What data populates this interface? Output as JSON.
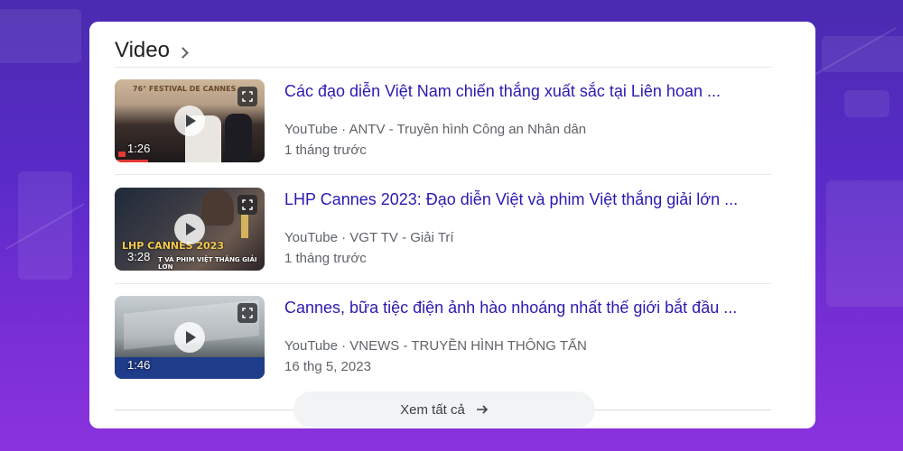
{
  "section": {
    "title": "Video"
  },
  "videos": [
    {
      "title": "Các đạo diễn Việt Nam chiến thắng xuất sắc tại Liên hoan ...",
      "source": "YouTube",
      "channel": "ANTV - Truyền hình Công an Nhân dân",
      "date": "1 tháng trước",
      "duration": "1:26",
      "overlay": "76° FESTIVAL DE CANNES",
      "progress": 0.22
    },
    {
      "title": "LHP Cannes 2023: Đạo diễn Việt và phim Việt thắng giải lớn ...",
      "source": "YouTube",
      "channel": "VGT TV - Giải Trí",
      "date": "1 tháng trước",
      "duration": "3:28",
      "overlay": "LHP CANNES 2023",
      "overlay2": "T VÀ PHIM VIỆT THẮNG GIẢI LỚN",
      "progress": 0
    },
    {
      "title": "Cannes, bữa tiệc điện ảnh hào nhoáng nhất thế giới bắt đầu ...",
      "source": "YouTube",
      "channel": "VNEWS - TRUYỀN HÌNH THÔNG TẤN",
      "date": "16 thg 5, 2023",
      "duration": "1:46",
      "overlay": "",
      "progress": 0
    }
  ],
  "see_all": {
    "label": "Xem tất cả"
  },
  "colors": {
    "link": "#2a1bb0",
    "meta": "#5f6368",
    "background": "#5a2bc8"
  },
  "icons": {
    "header": "chevron-right-icon",
    "play": "play-icon",
    "expand": "expand-icon",
    "see_all": "arrow-right-icon"
  }
}
